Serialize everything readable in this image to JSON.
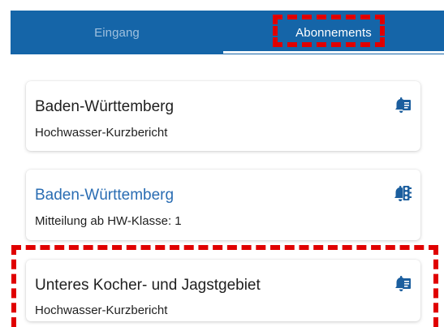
{
  "tabs": {
    "inbox_label": "Eingang",
    "subscriptions_label": "Abonnements",
    "active": "Abonnements"
  },
  "subscriptions": [
    {
      "title": "Baden-Württemberg",
      "subtitle": "Hochwasser-Kurzbericht",
      "icon": "document-bell-icon"
    },
    {
      "title": "Baden-Württemberg",
      "subtitle": "Mitteilung ab HW-Klasse: 1",
      "icon": "traffic-light-bell-icon"
    },
    {
      "title": "Unteres Kocher- und Jagstgebiet",
      "subtitle": "Hochwasser-Kurzbericht",
      "icon": "document-bell-icon"
    }
  ],
  "colors": {
    "tabbar": "#1565a8",
    "inactive_tab_text": "#9ec0de",
    "link_title": "#2a6db3",
    "highlight": "#e00000"
  }
}
